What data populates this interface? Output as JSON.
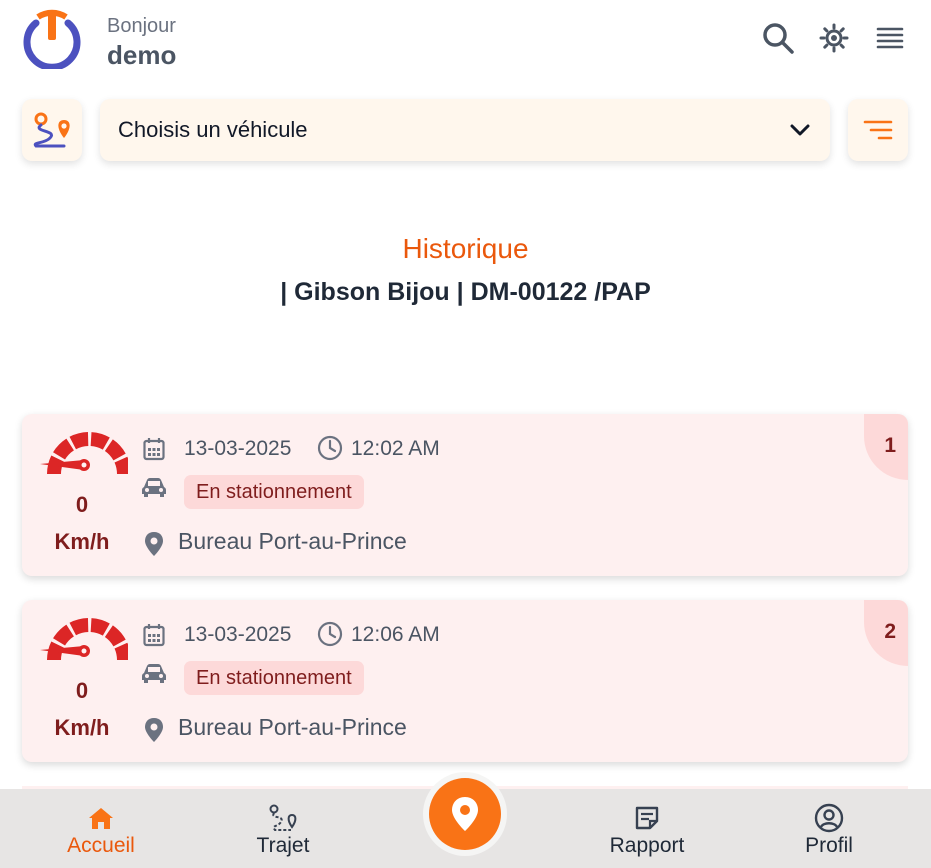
{
  "header": {
    "greeting": "Bonjour",
    "username": "demo",
    "icons": [
      "search-icon",
      "brightness-icon",
      "menu-icon"
    ],
    "accent": "#f97316"
  },
  "toolbar": {
    "vehicle_select": {
      "value": "Choisis un véhicule",
      "icon": "chevron-down-icon"
    },
    "left_icon": "route-icon",
    "right_icon": "filter-icon"
  },
  "history": {
    "title": "Historique",
    "subtitle": "| Gibson Bijou | DM-00122 /PAP"
  },
  "records": [
    {
      "index": "1",
      "speed": "0",
      "unit": "Km/h",
      "date": "13-03-2025",
      "time": "12:02 AM",
      "status": "En stationnement",
      "location": "Bureau Port-au-Prince"
    },
    {
      "index": "2",
      "speed": "0",
      "unit": "Km/h",
      "date": "13-03-2025",
      "time": "12:06 AM",
      "status": "En stationnement",
      "location": "Bureau Port-au-Prince"
    }
  ],
  "nav": {
    "items": [
      {
        "label": "Accueil",
        "icon": "home-icon",
        "active": true
      },
      {
        "label": "Trajet",
        "icon": "route-icon",
        "active": false
      },
      {
        "label": "Rapport",
        "icon": "report-icon",
        "active": false
      },
      {
        "label": "Profil",
        "icon": "profile-icon",
        "active": false
      }
    ],
    "center_icon": "location-pin-icon"
  },
  "colors": {
    "accent": "#f97316",
    "card_bg": "#fef0f0",
    "badge_bg": "#fdd9d9",
    "dark_red": "#7f1d1d",
    "gauge_red": "#dc2626"
  }
}
